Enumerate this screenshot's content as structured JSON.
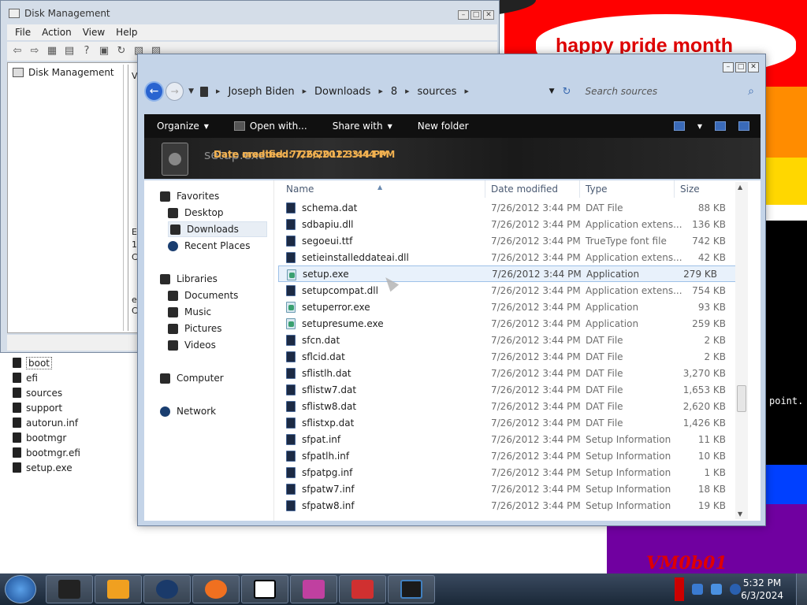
{
  "background": {
    "banner_text": "happy pride month",
    "console_text": "point.",
    "watermark": "VM0b01"
  },
  "disk_management": {
    "title": "Disk Management",
    "menu": [
      "File",
      "Action",
      "View",
      "Help"
    ],
    "tree_item": "Disk Management",
    "edge_letters": [
      "V",
      "E",
      "1",
      "C",
      "e",
      "C"
    ]
  },
  "desktop_files": [
    {
      "name": "boot",
      "selected": true
    },
    {
      "name": "efi",
      "selected": false
    },
    {
      "name": "sources",
      "selected": false
    },
    {
      "name": "support",
      "selected": false
    },
    {
      "name": "autorun.inf",
      "selected": false
    },
    {
      "name": "bootmgr",
      "selected": false
    },
    {
      "name": "bootmgr.efi",
      "selected": false
    },
    {
      "name": "setup.exe",
      "selected": false
    }
  ],
  "explorer": {
    "breadcrumb": [
      "Joseph Biden",
      "Downloads",
      "8",
      "sources"
    ],
    "search_placeholder": "Search sources",
    "toolbar": {
      "organize": "Organize",
      "open_with": "Open with...",
      "share_with": "Share with",
      "new_folder": "New folder"
    },
    "details": {
      "name": "setup.exe",
      "date": "Date modified: 7/26/2012 3:44 PM",
      "date_overlay": "Date created: 7/26/2012 3:44 PM"
    },
    "nav": {
      "favorites": "Favorites",
      "desktop": "Desktop",
      "downloads": "Downloads",
      "recent": "Recent Places",
      "libraries": "Libraries",
      "documents": "Documents",
      "music": "Music",
      "pictures": "Pictures",
      "videos": "Videos",
      "computer": "Computer",
      "network": "Network"
    },
    "columns": {
      "name": "Name",
      "date": "Date modified",
      "type": "Type",
      "size": "Size"
    },
    "files": [
      {
        "name": "schema.dat",
        "date": "7/26/2012 3:44 PM",
        "type": "DAT File",
        "size": "88 KB",
        "icon": "dat"
      },
      {
        "name": "sdbapiu.dll",
        "date": "7/26/2012 3:44 PM",
        "type": "Application extens...",
        "size": "136 KB",
        "icon": "dll"
      },
      {
        "name": "segoeui.ttf",
        "date": "7/26/2012 3:44 PM",
        "type": "TrueType font file",
        "size": "742 KB",
        "icon": "font"
      },
      {
        "name": "setieinstalleddateai.dll",
        "date": "7/26/2012 3:44 PM",
        "type": "Application extens...",
        "size": "42 KB",
        "icon": "dll"
      },
      {
        "name": "setup.exe",
        "date": "7/26/2012 3:44 PM",
        "type": "Application",
        "size": "279 KB",
        "icon": "exe",
        "selected": true
      },
      {
        "name": "setupcompat.dll",
        "date": "7/26/2012 3:44 PM",
        "type": "Application extens...",
        "size": "754 KB",
        "icon": "dll"
      },
      {
        "name": "setuperror.exe",
        "date": "7/26/2012 3:44 PM",
        "type": "Application",
        "size": "93 KB",
        "icon": "exe"
      },
      {
        "name": "setupresume.exe",
        "date": "7/26/2012 3:44 PM",
        "type": "Application",
        "size": "259 KB",
        "icon": "exe"
      },
      {
        "name": "sfcn.dat",
        "date": "7/26/2012 3:44 PM",
        "type": "DAT File",
        "size": "2 KB",
        "icon": "dat"
      },
      {
        "name": "sflcid.dat",
        "date": "7/26/2012 3:44 PM",
        "type": "DAT File",
        "size": "2 KB",
        "icon": "dat"
      },
      {
        "name": "sflistlh.dat",
        "date": "7/26/2012 3:44 PM",
        "type": "DAT File",
        "size": "3,270 KB",
        "icon": "dat"
      },
      {
        "name": "sflistw7.dat",
        "date": "7/26/2012 3:44 PM",
        "type": "DAT File",
        "size": "1,653 KB",
        "icon": "dat"
      },
      {
        "name": "sflistw8.dat",
        "date": "7/26/2012 3:44 PM",
        "type": "DAT File",
        "size": "2,620 KB",
        "icon": "dat"
      },
      {
        "name": "sflistxp.dat",
        "date": "7/26/2012 3:44 PM",
        "type": "DAT File",
        "size": "1,426 KB",
        "icon": "dat"
      },
      {
        "name": "sfpat.inf",
        "date": "7/26/2012 3:44 PM",
        "type": "Setup Information",
        "size": "11 KB",
        "icon": "inf"
      },
      {
        "name": "sfpatlh.inf",
        "date": "7/26/2012 3:44 PM",
        "type": "Setup Information",
        "size": "10 KB",
        "icon": "inf"
      },
      {
        "name": "sfpatpg.inf",
        "date": "7/26/2012 3:44 PM",
        "type": "Setup Information",
        "size": "1 KB",
        "icon": "inf"
      },
      {
        "name": "sfpatw7.inf",
        "date": "7/26/2012 3:44 PM",
        "type": "Setup Information",
        "size": "18 KB",
        "icon": "inf"
      },
      {
        "name": "sfpatw8.inf",
        "date": "7/26/2012 3:44 PM",
        "type": "Setup Information",
        "size": "19 KB",
        "icon": "inf"
      }
    ]
  },
  "taskbar": {
    "apps": [
      "terminal-app",
      "media-player",
      "browser-sphere",
      "firefox",
      "7zip",
      "paint-app",
      "toolbox-app",
      "monitor-app"
    ],
    "clock_time": "5:32 PM",
    "clock_date": "6/3/2024"
  },
  "colors": {
    "accent": "#2a64d0",
    "selection": "#e8f1fb",
    "toolbar": "#101010",
    "taskbar": "#1a2838"
  }
}
